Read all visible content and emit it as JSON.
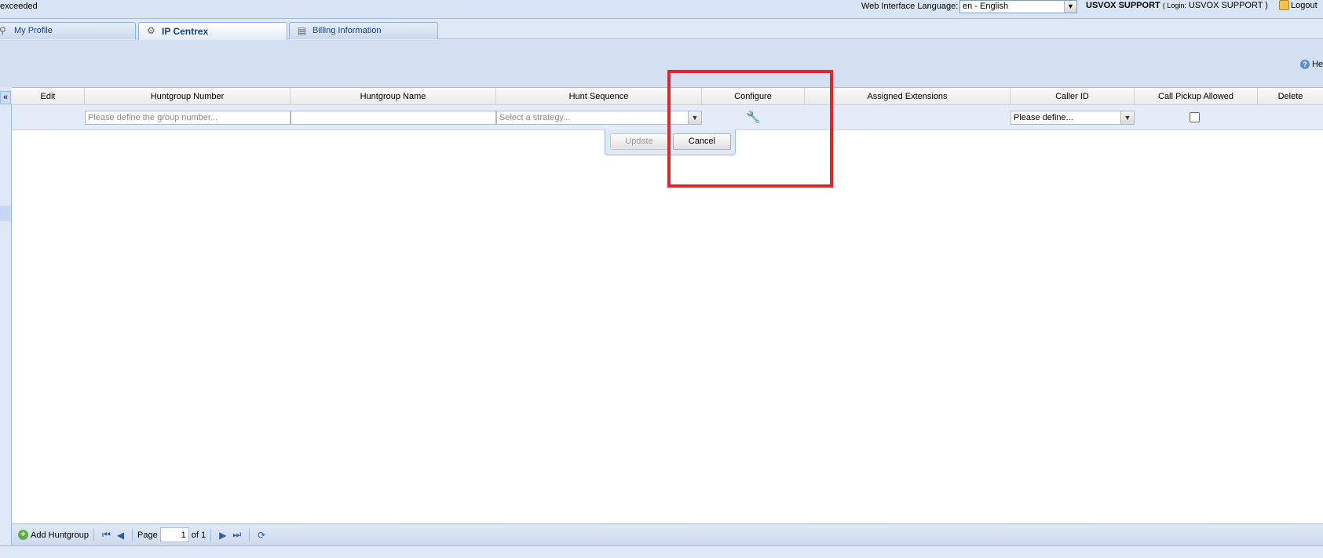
{
  "topbar": {
    "left_text": "exceeded",
    "lang_label": "Web Interface Language:",
    "lang_value": "en - English",
    "user_name": "USVOX SUPPORT",
    "login_prefix": "( Login:",
    "login_name": "USVOX SUPPORT )",
    "logout": "Logout"
  },
  "tabs": [
    {
      "label": "My Profile"
    },
    {
      "label": "IP Centrex"
    },
    {
      "label": "Billing Information"
    }
  ],
  "help": {
    "label": "He"
  },
  "grid": {
    "columns": [
      "Edit",
      "Huntgroup Number",
      "Huntgroup Name",
      "Hunt Sequence",
      "Configure",
      "Assigned Extensions",
      "Caller ID",
      "Call Pickup Allowed",
      "Delete"
    ],
    "edit_row": {
      "number_placeholder": "Please define the group number...",
      "name_value": "",
      "sequence_placeholder": "Select a strategy...",
      "callerid_value": "Please define...",
      "pickup_checked": false
    }
  },
  "buttons": {
    "update": "Update",
    "cancel": "Cancel"
  },
  "toolbar": {
    "add_label": "Add Huntgroup",
    "page_label": "Page",
    "page_value": "1",
    "of_label": "of 1"
  },
  "colors": {
    "highlight": "#e0262a",
    "accent": "#15428b"
  }
}
